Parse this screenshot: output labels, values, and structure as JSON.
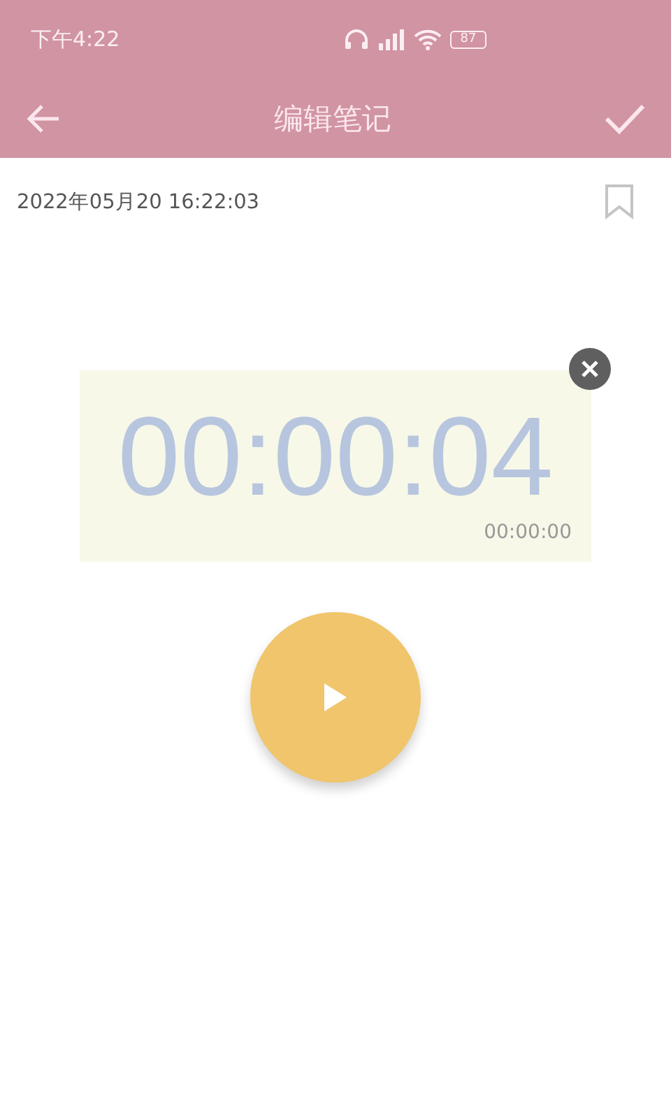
{
  "status_bar": {
    "time": "下午4:22",
    "battery": "87"
  },
  "toolbar": {
    "title": "编辑笔记"
  },
  "note": {
    "date": "2022年05月20 16:22:03",
    "bookmarked": false
  },
  "recording": {
    "elapsed": "00:00:04",
    "position": "00:00:00",
    "playing": false
  }
}
